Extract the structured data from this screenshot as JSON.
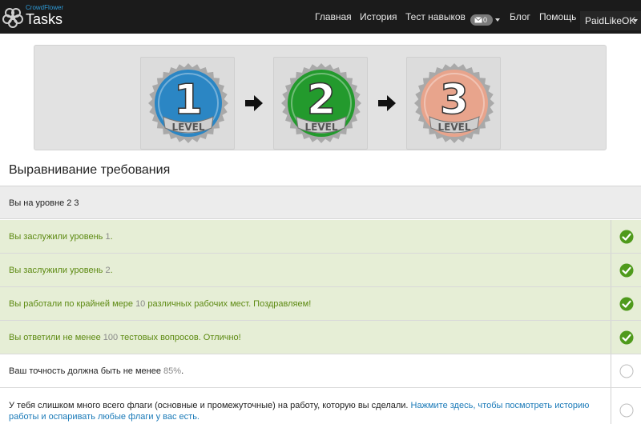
{
  "header": {
    "brand_small": "CrowdFlower",
    "brand_title": "Tasks",
    "nav": {
      "home": "Главная",
      "history": "История",
      "skills_test": "Тест навыков",
      "mail_count": "0",
      "blog": "Блог",
      "help": "Помощь",
      "user": "PaidLikeOK"
    }
  },
  "levels": [
    {
      "number": "1",
      "word": "LEVEL",
      "color": "#2b86c4"
    },
    {
      "number": "2",
      "word": "LEVEL",
      "color": "#239a2d"
    },
    {
      "number": "3",
      "word": "LEVEL",
      "color": "#e8a48c"
    }
  ],
  "title": "Выравнивание требования",
  "current_level": "Вы на уровне 2 3",
  "requirements": [
    {
      "pre": "Вы заслужили уровень ",
      "num": "1",
      "post": ".",
      "done": true
    },
    {
      "pre": "Вы заслужили уровень ",
      "num": "2",
      "post": ".",
      "done": true
    },
    {
      "pre": "Вы работали по крайней мере ",
      "num": "10",
      "post": " различных рабочих мест. Поздравляем!",
      "done": true
    },
    {
      "pre": "Вы ответили не менее ",
      "num": "100",
      "post": " тестовых вопросов. Отлично!",
      "done": true
    },
    {
      "pre": "Ваш точность должна быть не менее ",
      "num": "85%",
      "post": ".",
      "done": false
    },
    {
      "text": "У тебя слишком много всего флаги (основные и промежуточные) на работу, которую вы сделали. ",
      "link": "Нажмите здесь, чтобы посмотреть историю работы и оспаривать любые флаги у вас есть.",
      "done": false
    }
  ],
  "colors": {
    "navbar": "#1b1b1b",
    "done_row": "#e6eed6",
    "done_text": "#5d8a12",
    "check": "#4f9a1c",
    "link": "#1a7ab8"
  }
}
